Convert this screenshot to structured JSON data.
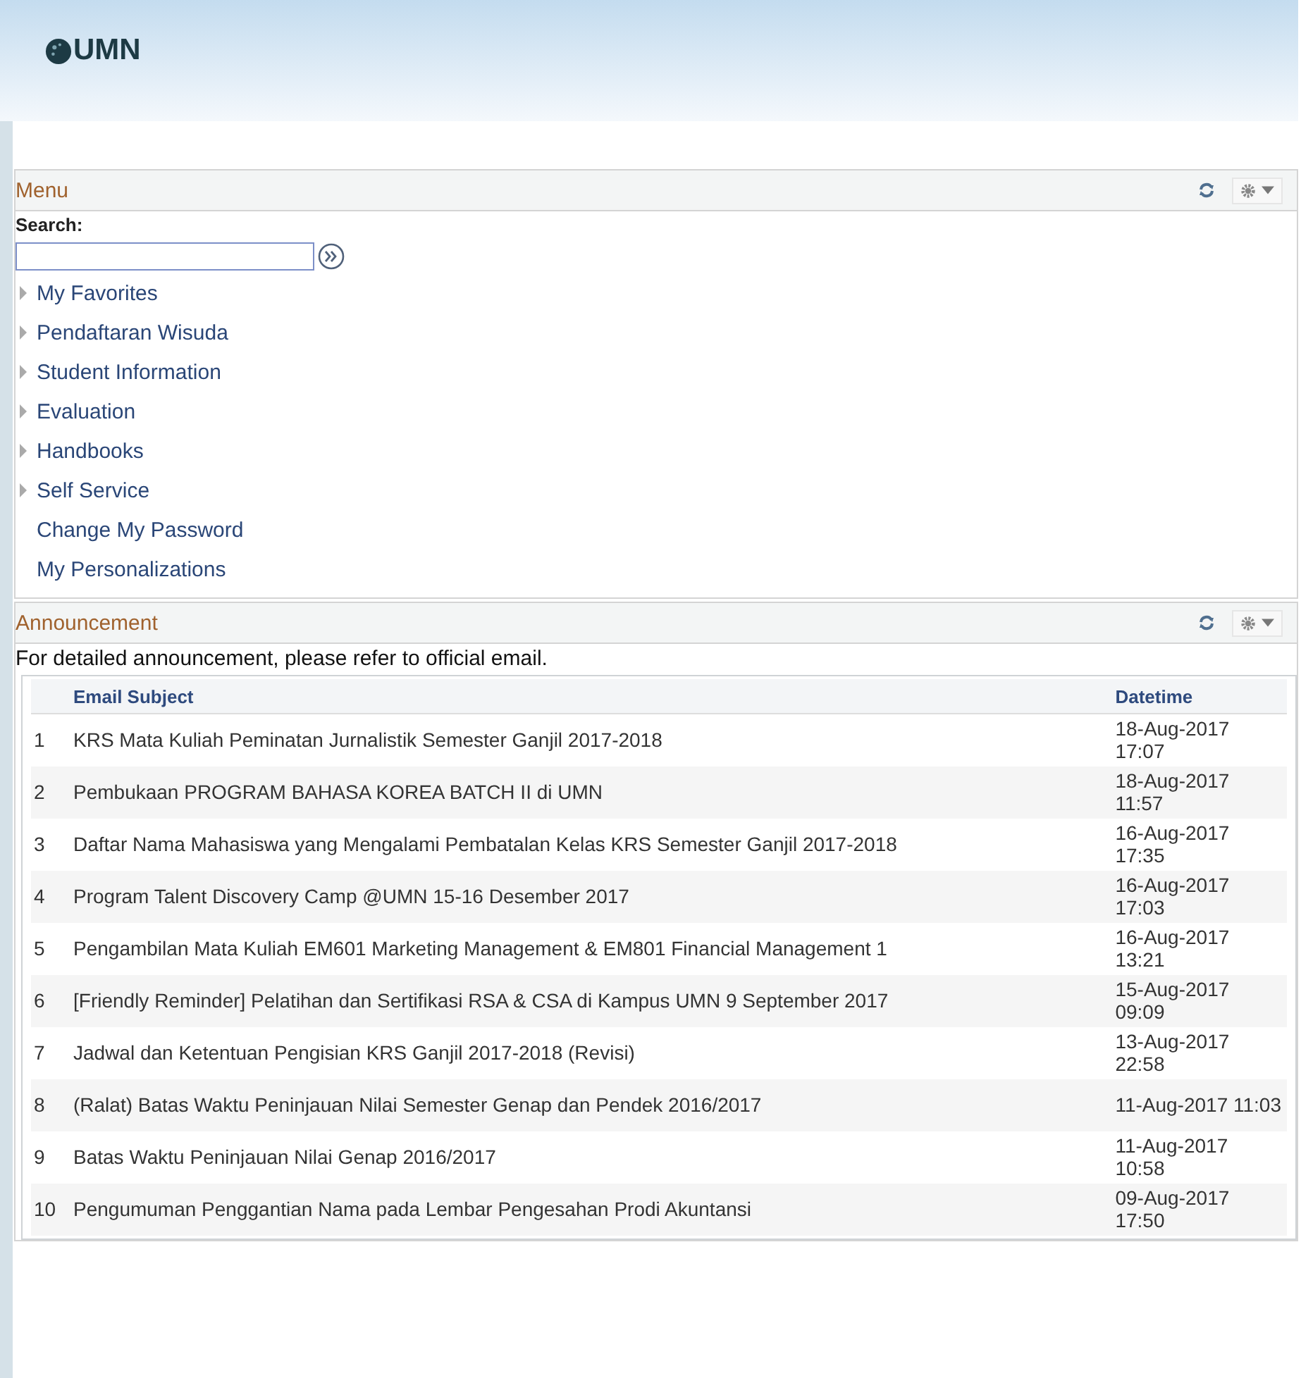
{
  "header": {
    "logo": "UMN"
  },
  "menu": {
    "title": "Menu",
    "search_label": "Search:",
    "items": [
      {
        "label": "My Favorites",
        "expandable": true
      },
      {
        "label": "Pendaftaran Wisuda",
        "expandable": true
      },
      {
        "label": "Student Information",
        "expandable": true
      },
      {
        "label": "Evaluation",
        "expandable": true
      },
      {
        "label": "Handbooks",
        "expandable": true
      },
      {
        "label": "Self Service",
        "expandable": true
      },
      {
        "label": "Change My Password",
        "expandable": false
      },
      {
        "label": "My Personalizations",
        "expandable": false
      }
    ]
  },
  "announcement": {
    "title": "Announcement",
    "note": "For detailed announcement, please refer to official email.",
    "columns": [
      "Email Subject",
      "Datetime"
    ],
    "rows": [
      {
        "no": "1",
        "subject": "KRS Mata Kuliah Peminatan Jurnalistik Semester Ganjil 2017-2018",
        "datetime": "18-Aug-2017 17:07",
        "one_line": false
      },
      {
        "no": "2",
        "subject": "Pembukaan PROGRAM BAHASA KOREA BATCH II di UMN",
        "datetime": "18-Aug-2017 11:57",
        "one_line": false
      },
      {
        "no": "3",
        "subject": "Daftar Nama Mahasiswa yang Mengalami Pembatalan Kelas KRS Semester Ganjil 2017-2018",
        "datetime": "16-Aug-2017 17:35",
        "one_line": false
      },
      {
        "no": "4",
        "subject": "Program Talent Discovery Camp @UMN 15-16 Desember 2017",
        "datetime": "16-Aug-2017 17:03",
        "one_line": false
      },
      {
        "no": "5",
        "subject": "Pengambilan Mata Kuliah EM601 Marketing Management & EM801 Financial Management 1",
        "datetime": "16-Aug-2017 13:21",
        "one_line": false
      },
      {
        "no": "6",
        "subject": "[Friendly Reminder] Pelatihan dan Sertifikasi RSA & CSA di Kampus UMN 9 September 2017",
        "datetime": "15-Aug-2017 09:09",
        "one_line": false
      },
      {
        "no": "7",
        "subject": "Jadwal dan Ketentuan Pengisian KRS Ganjil 2017-2018 (Revisi)",
        "datetime": "13-Aug-2017 22:58",
        "one_line": false
      },
      {
        "no": "8",
        "subject": "(Ralat) Batas Waktu Peninjauan Nilai Semester Genap dan Pendek 2016/2017",
        "datetime": "11-Aug-2017 11:03",
        "one_line": true
      },
      {
        "no": "9",
        "subject": "Batas Waktu Peninjauan Nilai Genap 2016/2017",
        "datetime": "11-Aug-2017 10:58",
        "one_line": false
      },
      {
        "no": "10",
        "subject": "Pengumuman Penggantian Nama pada Lembar Pengesahan Prodi Akuntansi",
        "datetime": "09-Aug-2017 17:50",
        "one_line": false
      }
    ]
  }
}
